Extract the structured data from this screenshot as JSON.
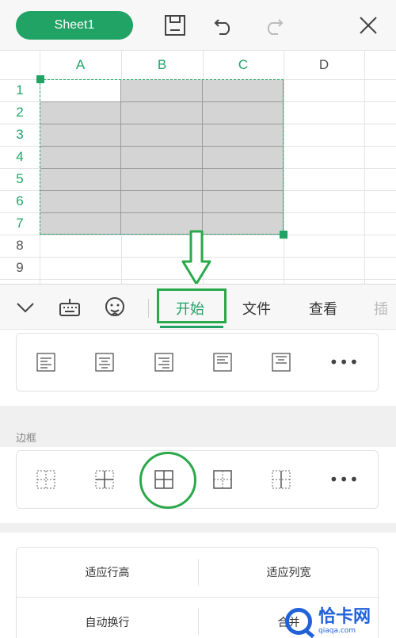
{
  "topbar": {
    "sheet_label": "Sheet1"
  },
  "grid": {
    "columns": [
      "A",
      "B",
      "C",
      "D"
    ],
    "rows": [
      "1",
      "2",
      "3",
      "4",
      "5",
      "6",
      "7",
      "8",
      "9"
    ]
  },
  "toolbar": {
    "tabs": [
      {
        "label": "开始"
      },
      {
        "label": "文件"
      },
      {
        "label": "查看"
      },
      {
        "label": "插"
      }
    ]
  },
  "alignment_panel": {
    "more_label": "•••"
  },
  "border_panel": {
    "section_label": "边框",
    "more_label": "•••"
  },
  "size_panel": {
    "fit_row_height": "适应行高",
    "fit_column_width": "适应列宽",
    "auto_wrap": "自动换行",
    "merge_partial": "合并"
  },
  "watermark": {
    "title": "恰卡网",
    "url": "qiaqa.com"
  },
  "colors": {
    "accent": "#21a366",
    "highlight": "#2aa84a",
    "selection": "#d4d4d4"
  }
}
